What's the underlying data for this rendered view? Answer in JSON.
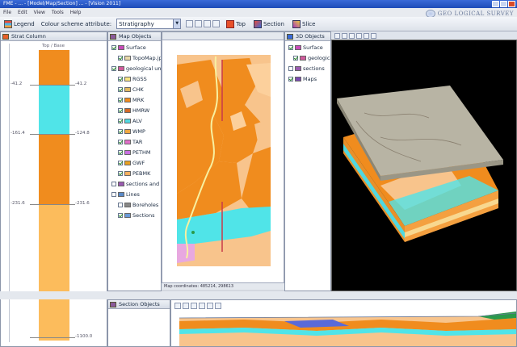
{
  "window": {
    "title": "FME - ... - [Model/Map/Section] ... - [Vision 2011]"
  },
  "brand": {
    "text": "GEO LOGICAL SURVEY"
  },
  "toolbar": {
    "legend_label": "Legend",
    "attribute_label": "Colour scheme attribute:",
    "attribute_value": "Stratigraphy",
    "top_label": "Top",
    "section_label": "Section",
    "slice_label": "Slice"
  },
  "strat_panel": {
    "tab": "Strat Column",
    "header": "Top / Base",
    "units": [
      {
        "color": "#f08c1e",
        "from": 0,
        "to": 0.12
      },
      {
        "color": "#50e4e8",
        "from": 0.12,
        "to": 0.29
      },
      {
        "color": "#f08c1e",
        "from": 0.29,
        "to": 0.53
      },
      {
        "color": "#fcbc5c",
        "from": 0.53,
        "to": 1
      }
    ],
    "depths_left": [
      "-41.2",
      "-161.4",
      "-231.6",
      ""
    ],
    "depths_right": [
      "-41.2",
      "-124.8",
      "-231.6",
      "-1100.0"
    ]
  },
  "map_tree": {
    "tab": "Map Objects",
    "items": [
      {
        "label": "Surface",
        "checked": true,
        "swatch": "#c84ab8"
      },
      {
        "label": "TopoMap.jpg",
        "checked": true,
        "swatch": "#e8d8a8"
      },
      {
        "label": "geological units",
        "checked": true,
        "swatch": "#d05a9c"
      },
      {
        "label": "RGSS",
        "checked": true,
        "swatch": "#f8e480"
      },
      {
        "label": "CHK",
        "checked": true,
        "swatch": "#e0b860"
      },
      {
        "label": "MRK",
        "checked": true,
        "swatch": "#f08c1e"
      },
      {
        "label": "HMRW",
        "checked": true,
        "swatch": "#d46a28"
      },
      {
        "label": "ALV",
        "checked": true,
        "swatch": "#50d8e0"
      },
      {
        "label": "WMP",
        "checked": true,
        "swatch": "#f0a840"
      },
      {
        "label": "TAR",
        "checked": true,
        "swatch": "#e070c8"
      },
      {
        "label": "PETHM",
        "checked": true,
        "swatch": "#c870e0"
      },
      {
        "label": "GWF",
        "checked": true,
        "swatch": "#e8a020"
      },
      {
        "label": "PEBMK",
        "checked": true,
        "swatch": "#f4b060"
      },
      {
        "label": "sections and lines",
        "checked": false,
        "swatch": "#9a5ab0"
      },
      {
        "label": "Lines",
        "checked": false,
        "swatch": "#5a8ac8"
      },
      {
        "label": "Boreholes",
        "checked": false,
        "swatch": "#888888"
      },
      {
        "label": "Sections",
        "checked": true,
        "swatch": "#6a9ad8"
      }
    ]
  },
  "map_status": "Map coordinates: 485214, 298613",
  "view3d_tree": {
    "tab": "3D Objects",
    "items": [
      {
        "label": "Surface",
        "checked": true,
        "swatch": "#c84ab8"
      },
      {
        "label": "geological units",
        "checked": true,
        "swatch": "#d05a9c"
      },
      {
        "label": "sections",
        "checked": false,
        "swatch": "#9a5ab0"
      },
      {
        "label": "Maps",
        "checked": true,
        "swatch": "#7a4ab0"
      }
    ]
  },
  "section_panel": {
    "tab": "Section Objects"
  },
  "menu": [
    "File",
    "Edit",
    "View",
    "Tools",
    "Help"
  ],
  "icons": {
    "legend": "legend-icon",
    "top": "top-icon",
    "section": "section-icon",
    "slice": "slice-icon"
  }
}
